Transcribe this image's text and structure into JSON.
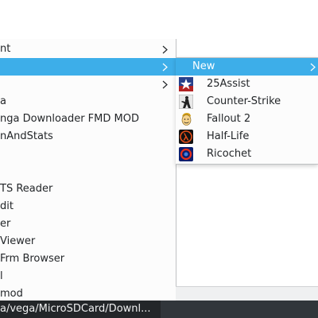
{
  "menu": {
    "items": [
      {
        "label": "nt",
        "submenu": true
      },
      {
        "label": "",
        "submenu": true,
        "active": true
      },
      {
        "label": "",
        "submenu": true
      },
      {
        "label": "a"
      },
      {
        "label": "nga Downloader FMD MOD"
      },
      {
        "label": "nAndStats"
      },
      {
        "label": ""
      },
      {
        "label": ""
      },
      {
        "label": "TS Reader"
      },
      {
        "label": "dit"
      },
      {
        "label": "er"
      },
      {
        "label": "Viewer"
      },
      {
        "label": " Frm Browser"
      },
      {
        "label": "l"
      },
      {
        "label": "mod"
      }
    ]
  },
  "submenu": {
    "header": "New",
    "items": [
      {
        "label": "25Assist",
        "icon": "assist-star-icon"
      },
      {
        "label": "Counter-Strike",
        "icon": "counter-strike-icon"
      },
      {
        "label": "Fallout 2",
        "icon": "vault-boy-icon"
      },
      {
        "label": "Half-Life",
        "icon": "half-life-lambda-icon"
      },
      {
        "label": "Ricochet",
        "icon": "ricochet-icon"
      }
    ]
  },
  "statusbar": {
    "path": "a/vega/MicroSDCard/Downl..."
  },
  "colors": {
    "highlight": "#3daee9",
    "menu_bg": "#fcfcfc",
    "statusbar_bg": "#232629"
  }
}
